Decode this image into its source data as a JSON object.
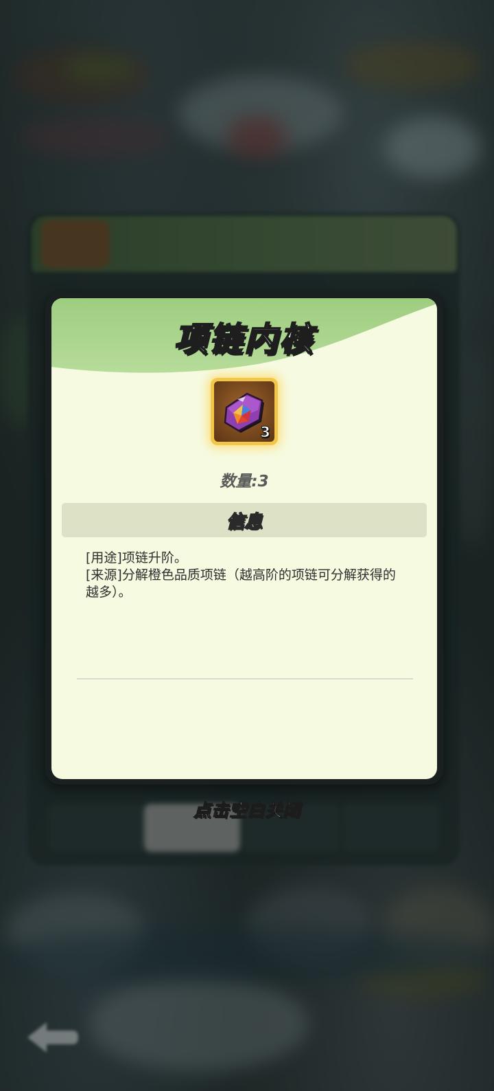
{
  "dialog": {
    "title": "项链内核",
    "item": {
      "icon": "necklace-core-gem-icon",
      "count": "3"
    },
    "quantity_label": "数量:",
    "quantity_value": "3",
    "section_title": "信息",
    "description": [
      "[用途]项链升阶。",
      "[来源]分解橙色品质项链（越高阶的项链可分解获得的越多）。"
    ]
  },
  "close_hint": "点击空白关闭",
  "colors": {
    "dialog_background": "#f6fae0",
    "header_green": "#a8d48a",
    "item_frame_gold": "#f2c64b",
    "section_bar": "#dde1c6"
  }
}
